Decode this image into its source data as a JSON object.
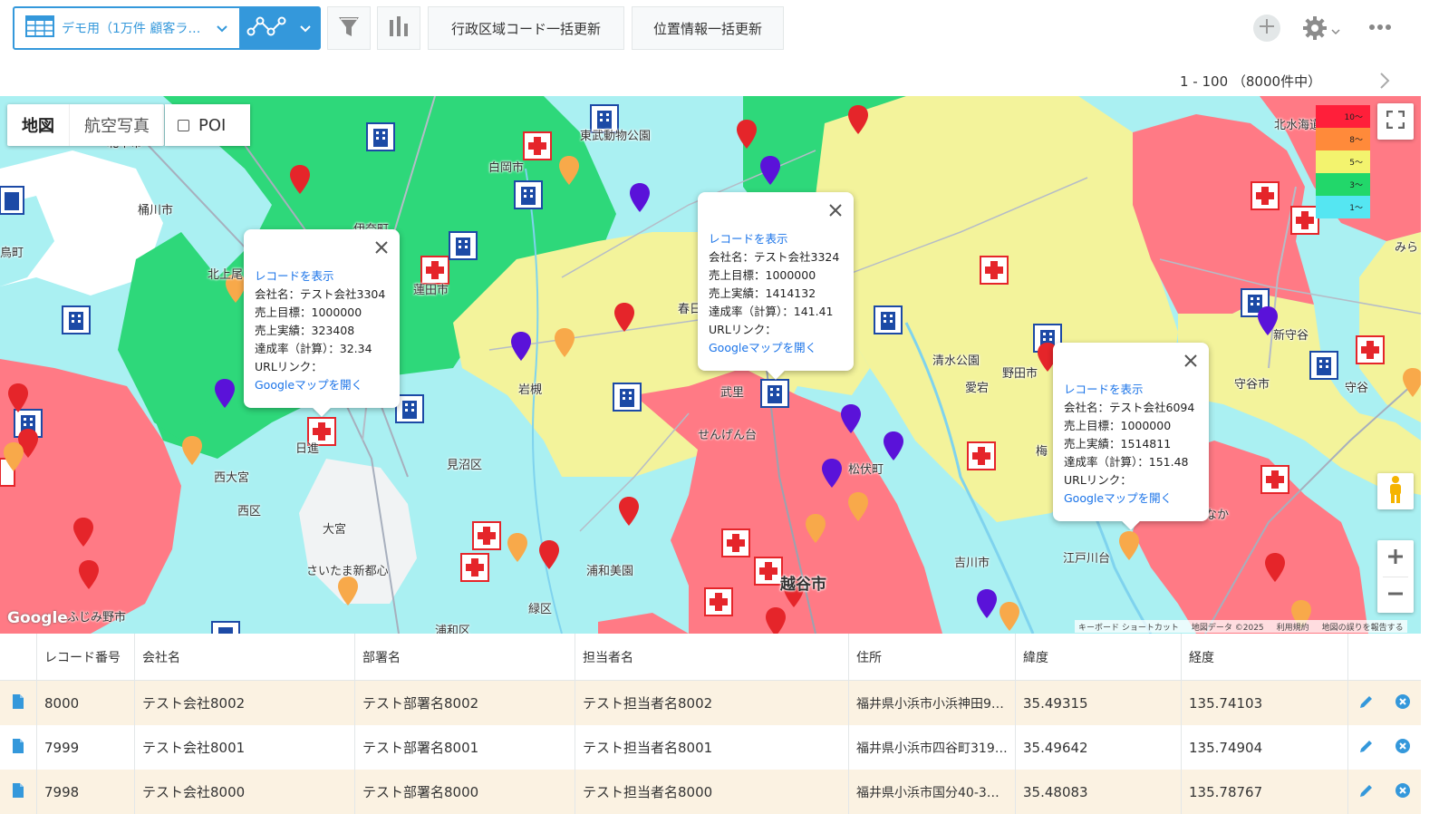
{
  "toolbar": {
    "view_name": "デモ用（1万件 顧客ラ…",
    "view_icon": "table-icon",
    "graph_icon": "graph-icon",
    "filter_icon": "filter-icon",
    "chart_icon": "bar-chart-icon",
    "btn_admin_code": "行政区域コード一括更新",
    "btn_geo_update": "位置情報一括更新",
    "add_icon": "plus-icon",
    "settings_icon": "gear-icon",
    "more_icon": "more-icon"
  },
  "pager": {
    "text": "1 - 100 （8000件中）"
  },
  "map": {
    "type_map": "地図",
    "type_satellite": "航空写真",
    "poi_label": "POI",
    "poi_checked": false,
    "legend": [
      {
        "label": "10〜",
        "color": "#ff1f3a"
      },
      {
        "label": "8〜",
        "color": "#ff8a3a"
      },
      {
        "label": "5〜",
        "color": "#f3f36e"
      },
      {
        "label": "3〜",
        "color": "#22d76a"
      },
      {
        "label": "1〜",
        "color": "#55e6f2"
      }
    ],
    "google": "Google",
    "attribution": [
      "キーボード ショートカット",
      "地図データ ©2025",
      "利用規約",
      "地図の誤りを報告する"
    ],
    "labels": [
      "北本市",
      "桶川市",
      "北上尾",
      "鳥町",
      "白岡市",
      "東武動物公園",
      "伊奈町",
      "蓮田市",
      "春日",
      "岩槻",
      "武里",
      "せんげん台",
      "松伏町",
      "吉川市",
      "越谷市",
      "野田市",
      "清水公園",
      "愛宕",
      "守谷市",
      "新守谷",
      "北水海道",
      "西大宮",
      "日進",
      "西区",
      "見沼区",
      "大宮",
      "さいたま新都心",
      "浦和美園",
      "緑区",
      "浦和区",
      "ふじみ野市",
      "江戸川台",
      "みら",
      "守谷",
      "梅",
      "なか"
    ]
  },
  "popups": [
    {
      "link": "レコードを表示",
      "company": "会社名：テスト会社3304",
      "target": "売上目標：1000000",
      "actual": "売上実績：323408",
      "rate": "達成率（計算）：32.34",
      "url": "URLリンク：",
      "gmap": "Googleマップを開く"
    },
    {
      "link": "レコードを表示",
      "company": "会社名：テスト会社3324",
      "target": "売上目標：1000000",
      "actual": "売上実績：1414132",
      "rate": "達成率（計算）：141.41",
      "url": "URLリンク：",
      "gmap": "Googleマップを開く"
    },
    {
      "link": "レコードを表示",
      "company": "会社名：テスト会社6094",
      "target": "売上目標：1000000",
      "actual": "売上実績：1514811",
      "rate": "達成率（計算）：151.48",
      "url": "URLリンク：",
      "gmap": "Googleマップを開く"
    }
  ],
  "table": {
    "headers": [
      "レコード番号",
      "会社名",
      "部署名",
      "担当者名",
      "住所",
      "緯度",
      "経度"
    ],
    "rows": [
      {
        "no": "8000",
        "company": "テスト会社8002",
        "dept": "テスト部署名8002",
        "person": "テスト担当者名8002",
        "address": "福井県小浜市小浜神田9…",
        "lat": "35.49315",
        "lng": "135.74103"
      },
      {
        "no": "7999",
        "company": "テスト会社8001",
        "dept": "テスト部署名8001",
        "person": "テスト担当者名8001",
        "address": "福井県小浜市四谷町319…",
        "lat": "35.49642",
        "lng": "135.74904"
      },
      {
        "no": "7998",
        "company": "テスト会社8000",
        "dept": "テスト部署名8000",
        "person": "テスト担当者名8000",
        "address": "福井県小浜市国分40-3…",
        "lat": "35.48083",
        "lng": "135.78767"
      }
    ]
  }
}
